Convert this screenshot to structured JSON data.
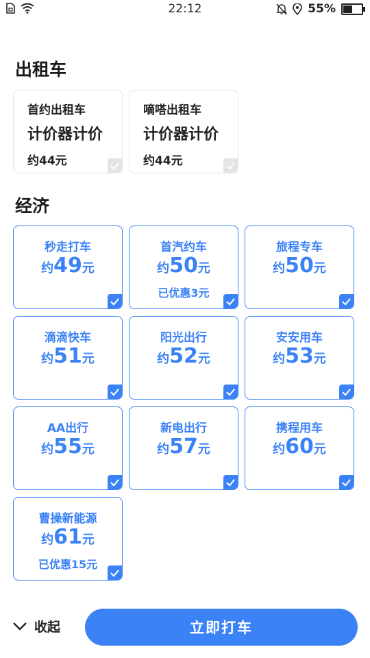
{
  "status_bar": {
    "time": "22:12",
    "battery": "55%",
    "battery_level": 0.55,
    "icons": [
      "sim-icon",
      "wifi-icon",
      "bell-muted-icon",
      "location-icon"
    ]
  },
  "sections": {
    "taxi_title": "出租车",
    "economy_title": "经济"
  },
  "taxi_cards": [
    {
      "name": "首约出租车",
      "meter": "计价器计价",
      "price": "约44元",
      "checked": false
    },
    {
      "name": "嘀嗒出租车",
      "meter": "计价器计价",
      "price": "约44元",
      "checked": false
    }
  ],
  "economy_cards": [
    {
      "name": "秒走打车",
      "prefix": "约",
      "amount": "49",
      "suffix": "元",
      "discount": "",
      "checked": true
    },
    {
      "name": "首汽约车",
      "prefix": "约",
      "amount": "50",
      "suffix": "元",
      "discount": "已优惠3元",
      "checked": true
    },
    {
      "name": "旅程专车",
      "prefix": "约",
      "amount": "50",
      "suffix": "元",
      "discount": "",
      "checked": true
    },
    {
      "name": "滴滴快车",
      "prefix": "约",
      "amount": "51",
      "suffix": "元",
      "discount": "",
      "checked": true
    },
    {
      "name": "阳光出行",
      "prefix": "约",
      "amount": "52",
      "suffix": "元",
      "discount": "",
      "checked": true
    },
    {
      "name": "安安用车",
      "prefix": "约",
      "amount": "53",
      "suffix": "元",
      "discount": "",
      "checked": true
    },
    {
      "name": "AA出行",
      "prefix": "约",
      "amount": "55",
      "suffix": "元",
      "discount": "",
      "checked": true
    },
    {
      "name": "新电出行",
      "prefix": "约",
      "amount": "57",
      "suffix": "元",
      "discount": "",
      "checked": true
    },
    {
      "name": "携程用车",
      "prefix": "约",
      "amount": "60",
      "suffix": "元",
      "discount": "",
      "checked": true
    },
    {
      "name": "曹操新能源",
      "prefix": "约",
      "amount": "61",
      "suffix": "元",
      "discount": "已优惠15元",
      "checked": true
    }
  ],
  "footer": {
    "collapse_label": "收起",
    "primary_label": "立即打车"
  },
  "colors": {
    "accent": "#3b82f6",
    "unchecked": "#e4e4e4"
  }
}
